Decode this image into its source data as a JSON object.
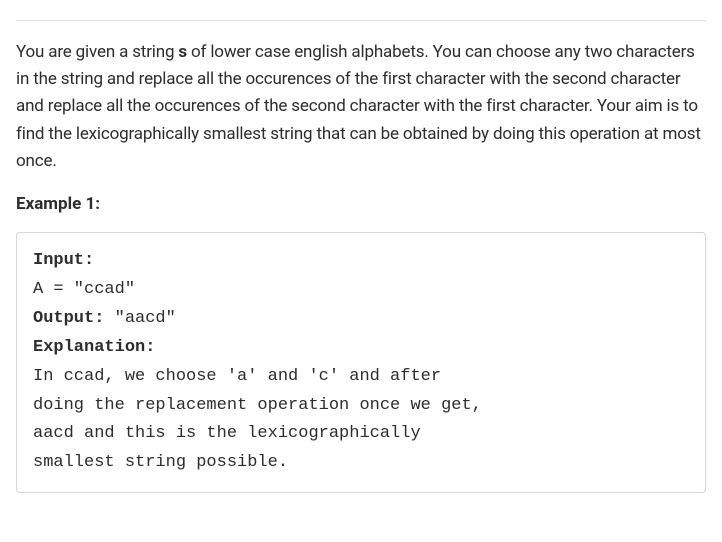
{
  "problem": {
    "description_prefix": "You are given a string ",
    "description_var": "s",
    "description_suffix": " of lower case english alphabets. You can choose any two characters in the string and replace all the occurences of the first character with the second character and replace all the occurences of the second character with the first character. Your aim is to find the lexicographically smallest string that can be obtained by doing this operation at most once."
  },
  "example": {
    "title": "Example 1:",
    "input_label": "Input:",
    "input_value": "A = \"ccad\"",
    "output_label": "Output: ",
    "output_value": "\"aacd\"",
    "explanation_label": "Explanation:",
    "explanation_text": "In ccad, we choose 'a' and 'c' and after \ndoing the replacement operation once we get, \naacd and this is the lexicographically\nsmallest string possible. "
  }
}
